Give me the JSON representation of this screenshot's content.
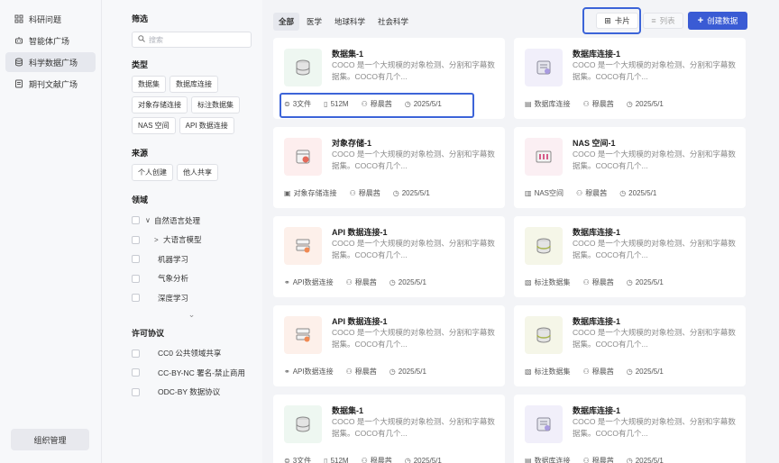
{
  "nav": {
    "items": [
      {
        "icon": "grid-icon",
        "label": "科研问题"
      },
      {
        "icon": "agent-icon",
        "label": "智能体广场"
      },
      {
        "icon": "database-icon",
        "label": "科学数据广场"
      },
      {
        "icon": "journal-icon",
        "label": "期刊文献广场"
      }
    ],
    "org_button": "组织管理"
  },
  "filter": {
    "title": "筛选",
    "search_placeholder": "搜索",
    "type_title": "类型",
    "type_tags": [
      "数据集",
      "数据库连接",
      "对象存储连接",
      "标注数据集",
      "NAS 空间",
      "API 数据连接"
    ],
    "source_title": "来源",
    "source_tags": [
      "个人创建",
      "他人共享"
    ],
    "domain_title": "领域",
    "domain_items": [
      {
        "label": "自然语言处理",
        "caret": "∨"
      },
      {
        "label": "大语言模型",
        "caret": ">"
      },
      {
        "label": "机器学习",
        "caret": ""
      },
      {
        "label": "气象分析",
        "caret": ""
      },
      {
        "label": "深度学习",
        "caret": ""
      }
    ],
    "expand_glyph": "⌄",
    "license_title": "许可协议",
    "license_items": [
      "CC0 公共领域共享",
      "CC-BY-NC 署名-禁止商用",
      "ODC-BY 数据协议"
    ]
  },
  "main": {
    "tabs": [
      "全部",
      "医学",
      "地球科学",
      "社会科学"
    ],
    "view_card": "卡片",
    "view_list": "列表",
    "create": "创建数据"
  },
  "desc": "COCO 是一个大规模的对象检测、分割和字幕数据集。COCO有几个...",
  "cards": [
    {
      "title": "数据集-1",
      "type": "dataset",
      "m1": "3文件",
      "m2": "512M",
      "user": "穆晨茜",
      "date": "2025/5/1"
    },
    {
      "title": "数据库连接-1",
      "type": "db",
      "m1": "数据库连接",
      "m2": "",
      "user": "穆晨茜",
      "date": "2025/5/1"
    },
    {
      "title": "对象存储-1",
      "type": "obj",
      "m1": "对象存储连接",
      "m2": "",
      "user": "穆晨茜",
      "date": "2025/5/1"
    },
    {
      "title": "NAS 空间-1",
      "type": "nas",
      "m1": "NAS空间",
      "m2": "",
      "user": "穆晨茜",
      "date": "2025/5/1"
    },
    {
      "title": "API 数据连接-1",
      "type": "api",
      "m1": "API数据连接",
      "m2": "",
      "user": "穆晨茜",
      "date": "2025/5/1"
    },
    {
      "title": "数据库连接-1",
      "type": "label",
      "m1": "标注数据集",
      "m2": "",
      "user": "穆晨茜",
      "date": "2025/5/1"
    },
    {
      "title": "API 数据连接-1",
      "type": "api",
      "m1": "API数据连接",
      "m2": "",
      "user": "穆晨茜",
      "date": "2025/5/1"
    },
    {
      "title": "数据库连接-1",
      "type": "label",
      "m1": "标注数据集",
      "m2": "",
      "user": "穆晨茜",
      "date": "2025/5/1"
    },
    {
      "title": "数据集-1",
      "type": "dataset",
      "m1": "3文件",
      "m2": "512M",
      "user": "穆晨茜",
      "date": "2025/5/1"
    },
    {
      "title": "数据库连接-1",
      "type": "db",
      "m1": "数据库连接",
      "m2": "",
      "user": "穆晨茜",
      "date": "2025/5/1"
    }
  ],
  "colors": {
    "accent": "#3a5bd4",
    "highlight": "#3c64d8"
  }
}
